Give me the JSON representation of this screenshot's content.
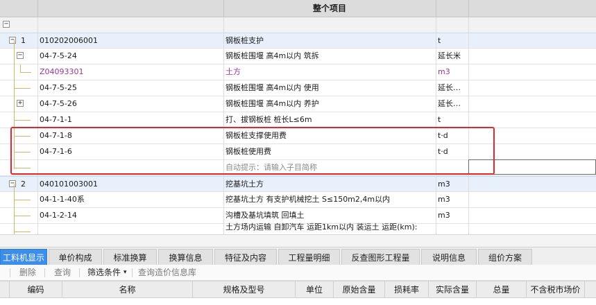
{
  "grid": {
    "header_title": "整个项目",
    "rows": [
      {
        "level": "1",
        "code": "010202006001",
        "name": "钢板桩支护",
        "unit": "t"
      },
      {
        "code": "04-7-5-24",
        "name": "钢板桩围堰 高4m以内 筑拆",
        "unit": "延长米"
      },
      {
        "code": "Z04093301",
        "name": "土方",
        "unit": "m3"
      },
      {
        "code": "04-7-5-25",
        "name": "钢板桩围堰 高4m以内 使用",
        "unit": "延长…"
      },
      {
        "code": "04-7-5-26",
        "name": "钢板桩围堰 高4m以内 养护",
        "unit": "延长…"
      },
      {
        "code": "04-7-1-1",
        "name": "打、拔钢板桩 桩长L≤6m",
        "unit": "t"
      },
      {
        "code": "04-7-1-8",
        "name": "钢板桩支撑使用费",
        "unit": "t·d"
      },
      {
        "code": "04-7-1-6",
        "name": "钢板桩使用费",
        "unit": "t·d"
      },
      {
        "code": "",
        "name": "自动提示：请输入子目简称",
        "unit": ""
      },
      {
        "level": "2",
        "code": "040101003001",
        "name": "挖基坑土方",
        "unit": "m3"
      },
      {
        "code": "04-1-1-40系",
        "name": "挖基坑土方 有支护机械挖土 S≤150m2,4m以内",
        "unit": "m3"
      },
      {
        "code": "04-1-2-14",
        "name": "沟槽及基坑填筑 回填土",
        "unit": "m3"
      },
      {
        "code": "",
        "name": "土方场内运输 自卸汽车 运距1km以内 装运土 运距(km):",
        "unit": ""
      }
    ]
  },
  "tabs": [
    {
      "label": "工料机显示",
      "active": true
    },
    {
      "label": "单价构成"
    },
    {
      "label": "标准换算"
    },
    {
      "label": "换算信息"
    },
    {
      "label": "特征及内容"
    },
    {
      "label": "工程量明细"
    },
    {
      "label": "反查图形工程量"
    },
    {
      "label": "说明信息"
    },
    {
      "label": "组价方案"
    }
  ],
  "toolbar": {
    "items": [
      "删除",
      "查询",
      "筛选条件",
      "查询造价信息库"
    ]
  },
  "columns": [
    "编码",
    "名称",
    "规格及型号",
    "单位",
    "原始含量",
    "损耗率",
    "实际含量",
    "总量",
    "不含税市场价"
  ],
  "icons": {
    "expanded": "minus-toggle-icon",
    "collapsed": "plus-toggle-icon",
    "dropdown": "chevron-down-icon"
  },
  "colors": {
    "active_tab": "#3d8ee8",
    "highlight_frame": "#e8242a",
    "row_blue": "#e7f0fb",
    "code_purple": "#993399"
  }
}
